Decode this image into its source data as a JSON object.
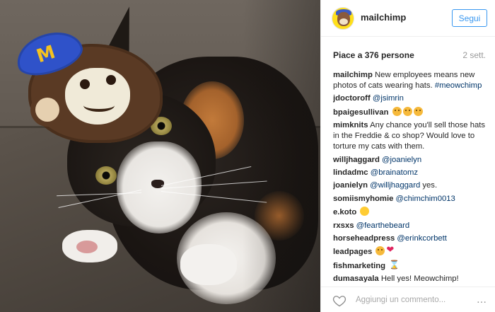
{
  "post": {
    "username": "mailchimp",
    "follow_label": "Segui",
    "likes": "Piace a 376 persone",
    "time": "2 sett."
  },
  "comments": [
    {
      "user": "mailchimp",
      "text": " New employees means new photos of cats wearing hats. ",
      "tag": "#meowchimp"
    },
    {
      "user": "jdoctoroff",
      "mention": "@jsimrin"
    },
    {
      "user": "bpaigesullivan",
      "emojis": [
        "smiling-cat",
        "smiling-cat",
        "smiling-cat"
      ]
    },
    {
      "user": "mimknits",
      "text": " Any chance you'll sell those hats in the Freddie & co shop? Would love to torture my cats with them."
    },
    {
      "user": "willjhaggard",
      "mention": "@joanielyn"
    },
    {
      "user": "lindadmc",
      "mention": "@brainatomz"
    },
    {
      "user": "joanielyn",
      "mention": "@willjhaggard",
      "text": " yes."
    },
    {
      "user": "somiismyhomie",
      "mention": "@chimchim0013"
    },
    {
      "user": "e.koto",
      "emojis": [
        "smiley"
      ]
    },
    {
      "user": "rxsxs",
      "mention": "@fearthebeard"
    },
    {
      "user": "horseheadpress",
      "mention": "@erinkcorbett"
    },
    {
      "user": "leadpages",
      "emojis": [
        "cat-face",
        "red-heart"
      ]
    },
    {
      "user": "fishmarketing",
      "emojis": [
        "hourglass"
      ]
    },
    {
      "user": "dumasayala",
      "text": " Hell yes! Meowchimp!"
    }
  ],
  "footer": {
    "comment_placeholder": "Aggiungi un commento...",
    "more_label": "…"
  },
  "colors": {
    "link": "#003569",
    "follow_blue": "#3897f0",
    "muted": "#999999"
  }
}
